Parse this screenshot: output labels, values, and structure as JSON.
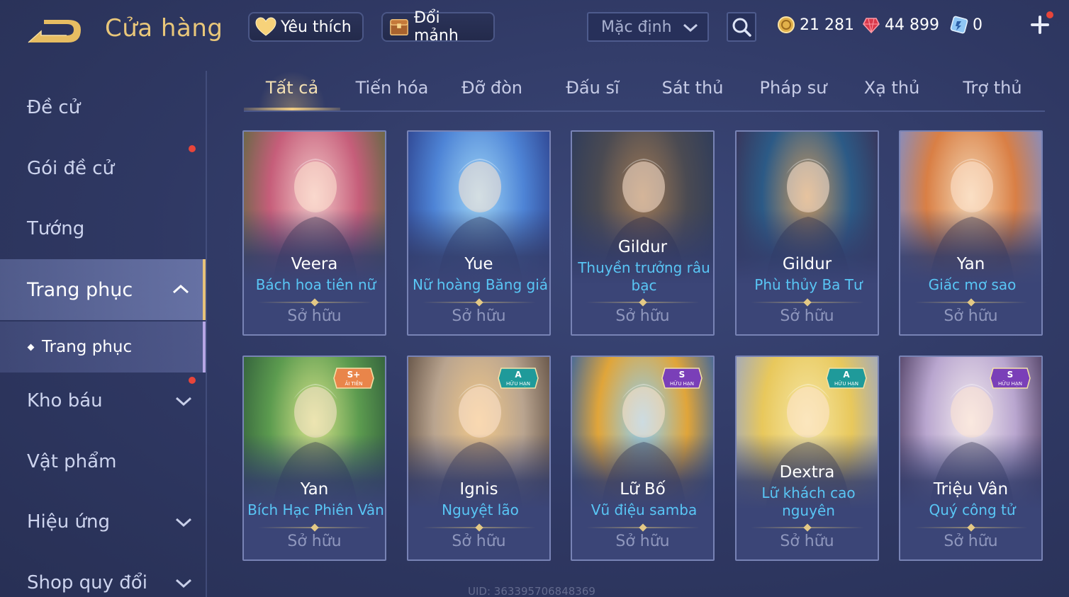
{
  "header": {
    "title": "Cửa hàng",
    "favorites_label": "Yêu thích",
    "exchange_label": "Đổi mảnh",
    "sort_value": "Mặc định",
    "currencies": {
      "gold": "21 281",
      "ruby": "44 899",
      "voucher": "0"
    }
  },
  "sidebar": {
    "items": [
      {
        "label": "Đề cử"
      },
      {
        "label": "Gói đề cử"
      },
      {
        "label": "Tướng"
      },
      {
        "label": "Trang phục"
      },
      {
        "label": "Kho báu"
      },
      {
        "label": "Vật phẩm"
      },
      {
        "label": "Hiệu ứng"
      },
      {
        "label": "Shop quy đổi"
      }
    ],
    "sub_item": "Trang phục"
  },
  "tabs": [
    "Tất cả",
    "Tiến hóa",
    "Đỡ đòn",
    "Đấu sĩ",
    "Sát thủ",
    "Pháp sư",
    "Xạ thủ",
    "Trợ thủ"
  ],
  "cards": [
    {
      "hero": "Veera",
      "skin": "Bách hoa tiên nữ",
      "status": "Sở hữu",
      "badge": "",
      "colors": [
        "#f3c8c8",
        "#c65e7a",
        "#5a6a3e"
      ]
    },
    {
      "hero": "Yue",
      "skin": "Nữ hoàng Băng giá",
      "status": "Sở hữu",
      "badge": "",
      "colors": [
        "#9fd6f7",
        "#4e84d6",
        "#2c3f8a"
      ]
    },
    {
      "hero": "Gildur",
      "skin": "Thuyền trưởng râu bạc",
      "status": "Sở hữu",
      "badge": "",
      "colors": [
        "#a07a55",
        "#4a4a52",
        "#2b3a5c"
      ]
    },
    {
      "hero": "Gildur",
      "skin": "Phù thủy Ba Tư",
      "status": "Sở hữu",
      "badge": "",
      "colors": [
        "#c99a62",
        "#2c5a86",
        "#3a3055"
      ]
    },
    {
      "hero": "Yan",
      "skin": "Giấc mơ sao",
      "status": "Sở hữu",
      "badge": "",
      "colors": [
        "#f4d7b4",
        "#d97f45",
        "#7b8fd0"
      ]
    },
    {
      "hero": "Yan",
      "skin": "Bích Hạc Phiên Vân",
      "status": "Sở hữu",
      "badge": "S+",
      "colors": [
        "#d7e48a",
        "#5c9b4f",
        "#2e5a3a"
      ]
    },
    {
      "hero": "Ignis",
      "skin": "Nguyệt lão",
      "status": "Sở hữu",
      "badge": "A",
      "colors": [
        "#f2c98a",
        "#b9a48f",
        "#5b4a3e"
      ]
    },
    {
      "hero": "Lữ Bố",
      "skin": "Vũ điệu samba",
      "status": "Sở hữu",
      "badge": "S",
      "colors": [
        "#8fd0f5",
        "#e0a53a",
        "#2c5fa8"
      ]
    },
    {
      "hero": "Dextra",
      "skin": "Lữ khách cao nguyên",
      "status": "Sở hữu",
      "badge": "A",
      "colors": [
        "#f6e7a6",
        "#e8c85c",
        "#9aa6c7"
      ]
    },
    {
      "hero": "Triệu Vân",
      "skin": "Quý công tử",
      "status": "Sở hữu",
      "badge": "S",
      "colors": [
        "#f4ecf0",
        "#b9a6cf",
        "#4a3a5e"
      ]
    }
  ],
  "badge_subtext": "HỮU HẠN",
  "badge_subtext_splus": "ẢI TIÊN",
  "uid_text": "UID: 363395706848369"
}
